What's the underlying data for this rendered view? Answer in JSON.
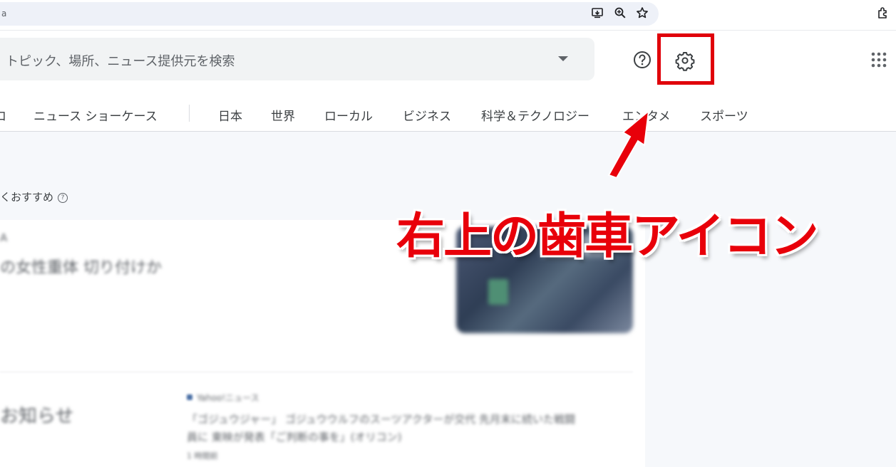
{
  "browser": {
    "address_text": "a",
    "icons": [
      "install-app-icon",
      "zoom-icon",
      "bookmark-star-icon",
      "extensions-icon"
    ]
  },
  "search": {
    "placeholder": "トピック、場所、ニュース提供元を検索"
  },
  "toolbar_icons": [
    "help-icon",
    "gear-icon",
    "apps-grid-icon"
  ],
  "nav": {
    "items": [
      {
        "label": "ロ"
      },
      {
        "label": "ニュース ショーケース"
      },
      {
        "label": "日本"
      },
      {
        "label": "世界"
      },
      {
        "label": "ローカル"
      },
      {
        "label": "ビジネス"
      },
      {
        "label": "科学＆テクノロジー"
      },
      {
        "label": "エンタメ"
      },
      {
        "label": "スポーツ"
      }
    ]
  },
  "content": {
    "recommend_header": "くおすすめ",
    "recommend_help": "?",
    "card1_line1": "A",
    "card1_headline": "の女性重体 切り付けか",
    "notice_title": "お知らせ",
    "news2_source": "Yahoo!ニュース",
    "news2_line1": "「ゴジュウジャー」 ゴジュウウルフのスーツアクターが交代 先月末に続いた戦闘",
    "news2_line2": "員に 東映が発表「ご判断の事を」(オリコン)",
    "news2_time": "1 時間前"
  },
  "annotation": {
    "text": "右上の歯車アイコン",
    "color": "#e8000a"
  },
  "colors": {
    "highlight": "#e0000a",
    "omnibox": "#eef1f8",
    "search_bg": "#f1f3f4",
    "page_bg": "#f6f8fb"
  }
}
